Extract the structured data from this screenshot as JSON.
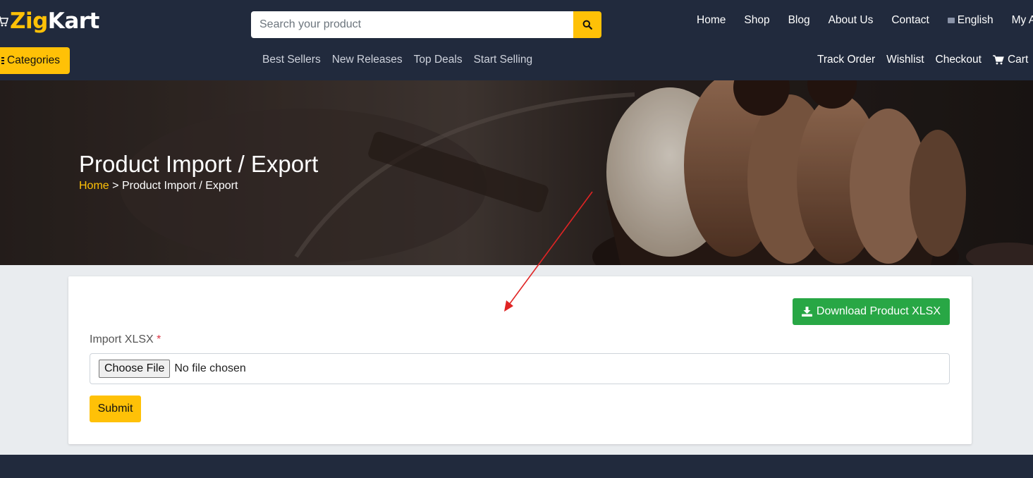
{
  "brand": {
    "part1": "Zig",
    "part2": "Kart"
  },
  "search": {
    "placeholder": "Search your product"
  },
  "top_nav": [
    {
      "label": "Home"
    },
    {
      "label": "Shop"
    },
    {
      "label": "Blog"
    },
    {
      "label": "About Us"
    },
    {
      "label": "Contact"
    },
    {
      "label": "English"
    },
    {
      "label": "My Ac"
    }
  ],
  "categories_label": "Categories",
  "sub_nav": [
    {
      "label": "Best Sellers"
    },
    {
      "label": "New Releases"
    },
    {
      "label": "Top Deals"
    },
    {
      "label": "Start Selling"
    }
  ],
  "right_nav": [
    {
      "label": "Track Order"
    },
    {
      "label": "Wishlist"
    },
    {
      "label": "Checkout"
    },
    {
      "label": "Cart"
    }
  ],
  "banner": {
    "title": "Product Import / Export",
    "breadcrumb_home": "Home",
    "breadcrumb_separator": ">",
    "breadcrumb_current": "Product Import / Export"
  },
  "form": {
    "download_label": "Download Product XLSX",
    "import_label": "Import XLSX",
    "required_mark": "*",
    "choose_file_label": "Choose File",
    "file_status": "No file chosen",
    "submit_label": "Submit"
  },
  "colors": {
    "header_bg": "#212a3d",
    "accent": "#ffc107",
    "download_green": "#28a745",
    "annotation_red": "#e02424"
  }
}
